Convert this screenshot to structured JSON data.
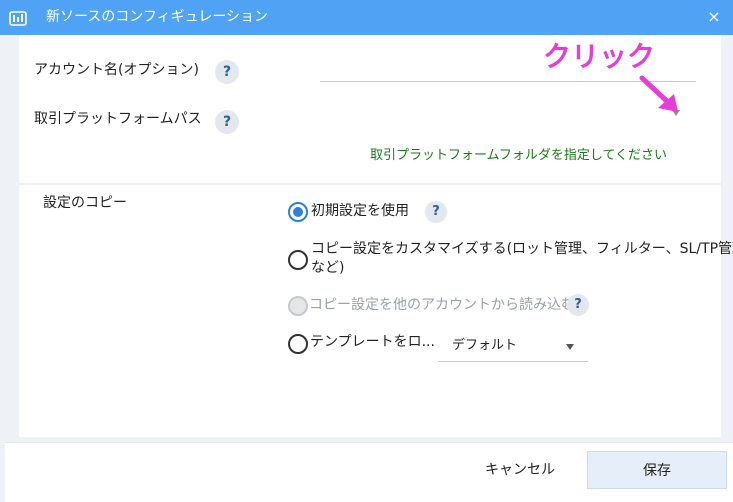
{
  "window": {
    "title": "新ソースのコンフィギュレーション",
    "close_glyph": "×"
  },
  "account": {
    "label": "アカウント名(オプション)",
    "help": "?",
    "value": "",
    "placeholder": ""
  },
  "platform_path": {
    "label": "取引プラットフォームパス",
    "help": "?",
    "hint": "取引プラットフォームフォルダを指定してください"
  },
  "annotation": {
    "text": "クリック",
    "color": "#e83cd8"
  },
  "copy_settings": {
    "label": "設定のコピー",
    "options": [
      {
        "label": "初期設定を使用",
        "help": "?",
        "state": "checked"
      },
      {
        "label_line1": "コピー設定をカスタマイズする(ロット管理、フィルター、SL/TP管理",
        "label_line2": "など)",
        "state": "unchecked"
      },
      {
        "label": "コピー設定を他のアカウントから読み込む",
        "help": "?",
        "state": "disabled"
      },
      {
        "label": "テンプレートをロ...",
        "state": "unchecked",
        "select_value": "デフォルト"
      }
    ]
  },
  "footer": {
    "cancel_label": "キャンセル",
    "save_label": "保存"
  },
  "colors": {
    "titlebar": "#4fa2f4",
    "accent": "#2d7fe0",
    "hint": "#1a7a1a"
  }
}
